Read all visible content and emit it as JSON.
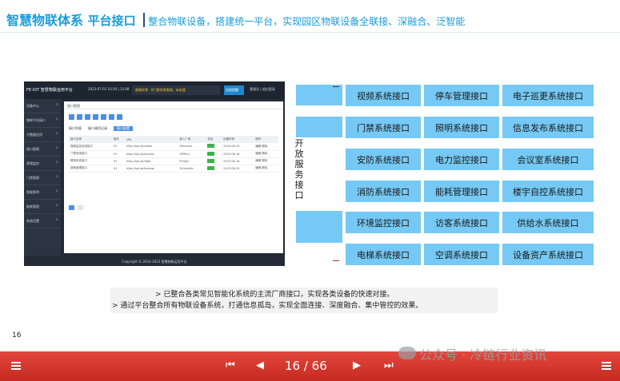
{
  "header": {
    "main_title": "智慧物联体系",
    "sub_title": "平台接口",
    "tagline": "整合物联设备，搭建统一平台，实现园区物联设备全联接、深融合、泛智能"
  },
  "app_screenshot": {
    "logo": "FE-IOT 智慧物联运用平台",
    "time": "2023-07-01 10:30 | 13:48",
    "alert": "故障异常：B门禁异常离线，未处理",
    "alert_button": "消息提醒",
    "user": "管理员 | 退出登录",
    "sidebar": [
      "设备中心",
      "物联平台接口",
      "大数据应用",
      "接口管理",
      "视频监控",
      "门禁管理",
      "智能照明",
      "能耗管理",
      "系统设置"
    ],
    "breadcrumb": "接口管理",
    "subtabs": [
      "接口列表",
      "接口调用记录",
      "接口配置"
    ],
    "table_headers": [
      "接口名称",
      "版本",
      "URL",
      "接入厂家",
      "状态",
      "创建时间",
      "操作"
    ],
    "table_rows": [
      [
        "视频监控系统接口",
        "V1",
        "http://api.iot/video",
        "Hikvision",
        "",
        "2023-06-15",
        "编辑 删除"
      ],
      [
        "门禁系统接口",
        "V1",
        "http://api.iot/access",
        "ZKTeco",
        "",
        "2023-06-16",
        "编辑 删除"
      ],
      [
        "照明系统接口",
        "V1",
        "http://api.iot/light",
        "Philips",
        "",
        "2023-06-18",
        "编辑 删除"
      ],
      [
        "能耗管理接口",
        "V1",
        "http://api.iot/energy",
        "Schneider",
        "",
        "2023-06-20",
        "编辑 删除"
      ]
    ],
    "footer": "Copyright © 2014-2023 智慧物联运用平台"
  },
  "interfaces": {
    "vertical_label": "开放服务接口",
    "rows": [
      [
        "视频系统接口",
        "停车管理接口",
        "电子巡更系统接口"
      ],
      [
        "门禁系统接口",
        "照明系统接口",
        "信息发布系统接口"
      ],
      [
        "安防系统接口",
        "电力监控接口",
        "会议室系统接口"
      ],
      [
        "消防系统接口",
        "能耗管理接口",
        "楼宇自控系统接口"
      ],
      [
        "环境监控接口",
        "访客系统接口",
        "供给水系统接口"
      ],
      [
        "电梯系统接口",
        "空调系统接口",
        "设备资产系统接口"
      ]
    ]
  },
  "notes": {
    "line1": "> 已整合各类常见智能化系统的主流厂商接口，实现各类设备的快速对接。",
    "line2": "> 通过平台整合所有物联设备系统，打通信息孤岛，实现全面连接、深度融合、集中管控的效果。"
  },
  "page_number": "16",
  "viewer": {
    "page_counter": "16 / 66",
    "watermark": "公众号 · 冷链行业资讯"
  },
  "colors": {
    "title_blue": "#1b9bd8",
    "interface_box": "#75c9f4",
    "bar_red": "#d9362d"
  }
}
